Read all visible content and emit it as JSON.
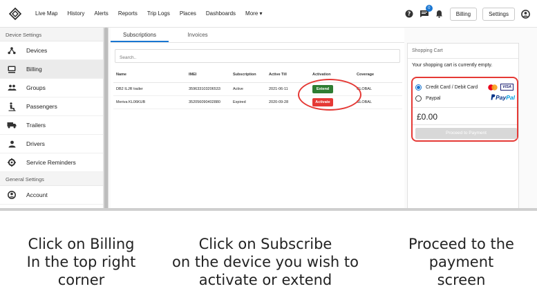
{
  "topbar": {
    "nav": [
      "Live Map",
      "History",
      "Alerts",
      "Reports",
      "Trip Logs",
      "Places",
      "Dashboards",
      "More"
    ],
    "notification_count": "0",
    "billing_label": "Billing",
    "settings_label": "Settings"
  },
  "sidebar": {
    "device_settings_label": "Device Settings",
    "items": [
      {
        "label": "Devices",
        "icon": "sitemap-icon"
      },
      {
        "label": "Billing",
        "icon": "billing-icon"
      },
      {
        "label": "Groups",
        "icon": "groups-icon"
      },
      {
        "label": "Passengers",
        "icon": "passengers-icon"
      },
      {
        "label": "Trailers",
        "icon": "truck-icon"
      },
      {
        "label": "Drivers",
        "icon": "driver-icon"
      },
      {
        "label": "Service Reminders",
        "icon": "cog-icon"
      }
    ],
    "general_settings_label": "General Settings",
    "account_label": "Account"
  },
  "main": {
    "tabs": [
      "Subscriptions",
      "Invoices"
    ],
    "search_placeholder": "Search..",
    "columns": [
      "Name",
      "IMEI",
      "Subscription",
      "Active Till",
      "Activation",
      "Coverage"
    ],
    "rows": [
      {
        "name": "DB2 ILJR trailer",
        "imei": "359633103206533",
        "subscription": "Active",
        "active_till": "2021-06-11",
        "action": "Extend",
        "coverage": "GLOBAL"
      },
      {
        "name": "Meriva KL06KUB",
        "imei": "352056090402880",
        "subscription": "Expired",
        "active_till": "2020-09-28",
        "action": "Activate",
        "coverage": "GLOBAL"
      }
    ]
  },
  "cart": {
    "title": "Shopping Cart",
    "empty_text": "Your shopping cart is currently empty.",
    "option_card": "Credit Card / Debit Card",
    "option_paypal": "Paypal",
    "visa_text": "VISA",
    "paypal_brand_1": "Pay",
    "paypal_brand_2": "Pal",
    "total": "£0.00",
    "proceed_label": "Proceed to Payment"
  },
  "captions": {
    "step1": "Click on Billing\nIn the top right\ncorner",
    "step2": "Click on Subscribe\non the device you wish to\nactivate or extend",
    "step3": "Proceed to the\npayment\nscreen"
  },
  "colors": {
    "accent": "#1976d2",
    "extend": "#2e7d32",
    "activate": "#e53935",
    "highlight": "#e53935"
  }
}
